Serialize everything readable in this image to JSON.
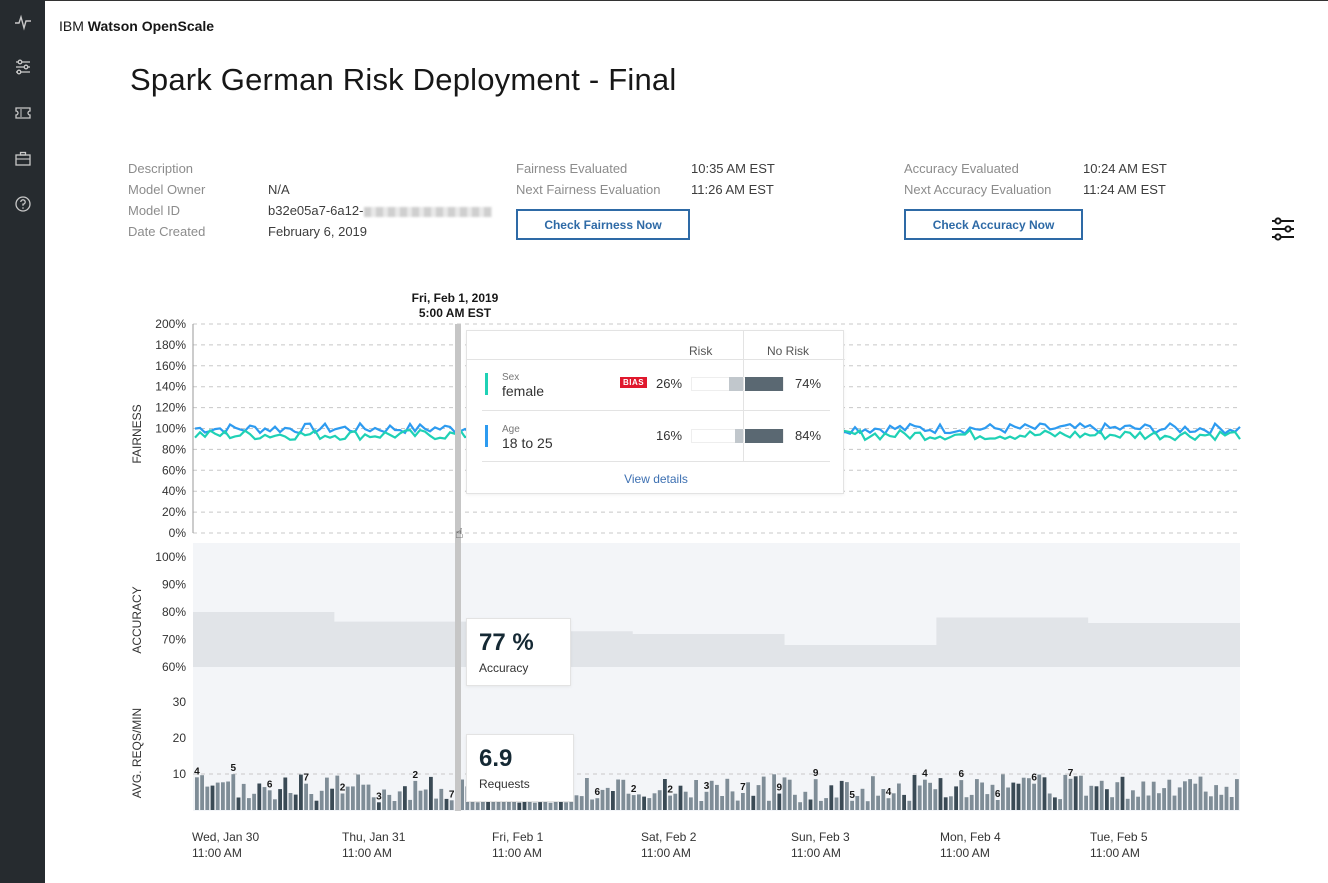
{
  "app": {
    "brand_prefix": "IBM ",
    "brand_name": "Watson OpenScale"
  },
  "sidebar": {
    "items": [
      {
        "name": "activity-icon"
      },
      {
        "name": "sliders-icon"
      },
      {
        "name": "ticket-icon"
      },
      {
        "name": "briefcase-icon"
      },
      {
        "name": "help-icon"
      }
    ]
  },
  "page": {
    "title": "Spark German Risk Deployment - Final"
  },
  "meta": {
    "description_label": "Description",
    "owner_label": "Model Owner",
    "owner_value": "N/A",
    "model_id_label": "Model ID",
    "model_id_value": "b32e05a7-6a12-",
    "date_created_label": "Date Created",
    "date_created_value": "February 6, 2019",
    "fairness_evaluated_label": "Fairness Evaluated",
    "fairness_evaluated_value": "10:35 AM EST",
    "next_fairness_label": "Next Fairness Evaluation",
    "next_fairness_value": "11:26 AM EST",
    "check_fairness_label": "Check Fairness Now",
    "accuracy_evaluated_label": "Accuracy Evaluated",
    "accuracy_evaluated_value": "10:24 AM EST",
    "next_accuracy_label": "Next Accuracy Evaluation",
    "next_accuracy_value": "11:24 AM EST",
    "check_accuracy_label": "Check Accuracy Now"
  },
  "selection": {
    "date": "Fri, Feb 1, 2019",
    "time": "5:00 AM EST"
  },
  "fairness_popup": {
    "risk_label": "Risk",
    "no_risk_label": "No Risk",
    "rows": [
      {
        "attribute": "Sex",
        "group": "female",
        "bias": "BIAS",
        "risk": "26%",
        "no_risk": "74%",
        "risk_value": 0.26,
        "color": "#1fd1b5"
      },
      {
        "attribute": "Age",
        "group": "18 to 25",
        "bias": "",
        "risk": "16%",
        "no_risk": "84%",
        "risk_value": 0.16,
        "color": "#2d9bf0"
      }
    ],
    "view_details": "View details"
  },
  "accuracy_popup": {
    "value": "77 %",
    "label": "Accuracy"
  },
  "requests_popup": {
    "value": "6.9",
    "label": "Requests"
  },
  "chart_data": {
    "type": "line",
    "panels": [
      {
        "name": "fairness",
        "ylabel": "FAIRNESS",
        "ticks": [
          "200%",
          "180%",
          "160%",
          "140%",
          "120%",
          "100%",
          "80%",
          "60%",
          "40%",
          "20%",
          "0%"
        ],
        "ylim": [
          0,
          200
        ],
        "series": [
          {
            "color": "#2d9bf0",
            "level": 100
          },
          {
            "color": "#1fd1b5",
            "level": 94
          }
        ]
      },
      {
        "name": "accuracy",
        "ylabel": "ACCURACY",
        "type": "area",
        "ticks": [
          "100%",
          "90%",
          "80%",
          "70%",
          "60%"
        ],
        "ylim": [
          55,
          100
        ],
        "steps": [
          {
            "x": 0,
            "v": 80
          },
          {
            "x": 0.135,
            "v": 76.5
          },
          {
            "x": 0.36,
            "v": 73
          },
          {
            "x": 0.42,
            "v": 72
          },
          {
            "x": 0.565,
            "v": 68
          },
          {
            "x": 0.71,
            "v": 78
          },
          {
            "x": 0.855,
            "v": 76
          },
          {
            "x": 1.0,
            "v": 76
          }
        ]
      },
      {
        "name": "requests",
        "ylabel": "AVG. REQS/MIN",
        "type": "bar",
        "ticks": [
          "30",
          "20",
          "10"
        ],
        "ylim": [
          0,
          35
        ],
        "labels": [
          "4",
          "5",
          "6",
          "7",
          "2",
          "3",
          "2",
          "7",
          "6",
          "2",
          "2",
          "3",
          "7",
          "9",
          "9",
          "5",
          "4",
          "4",
          "6",
          "6",
          "6",
          "7"
        ]
      }
    ],
    "categories": [
      "Wed, Jan 30",
      "Thu, Jan 31",
      "Fri, Feb 1",
      "Sat, Feb 2",
      "Sun, Feb 3",
      "Mon, Feb 4",
      "Tue, Feb 5"
    ],
    "category_times": [
      "11:00 AM",
      "11:00 AM",
      "11:00 AM",
      "11:00 AM",
      "11:00 AM",
      "11:00 AM",
      "11:00 AM"
    ]
  }
}
